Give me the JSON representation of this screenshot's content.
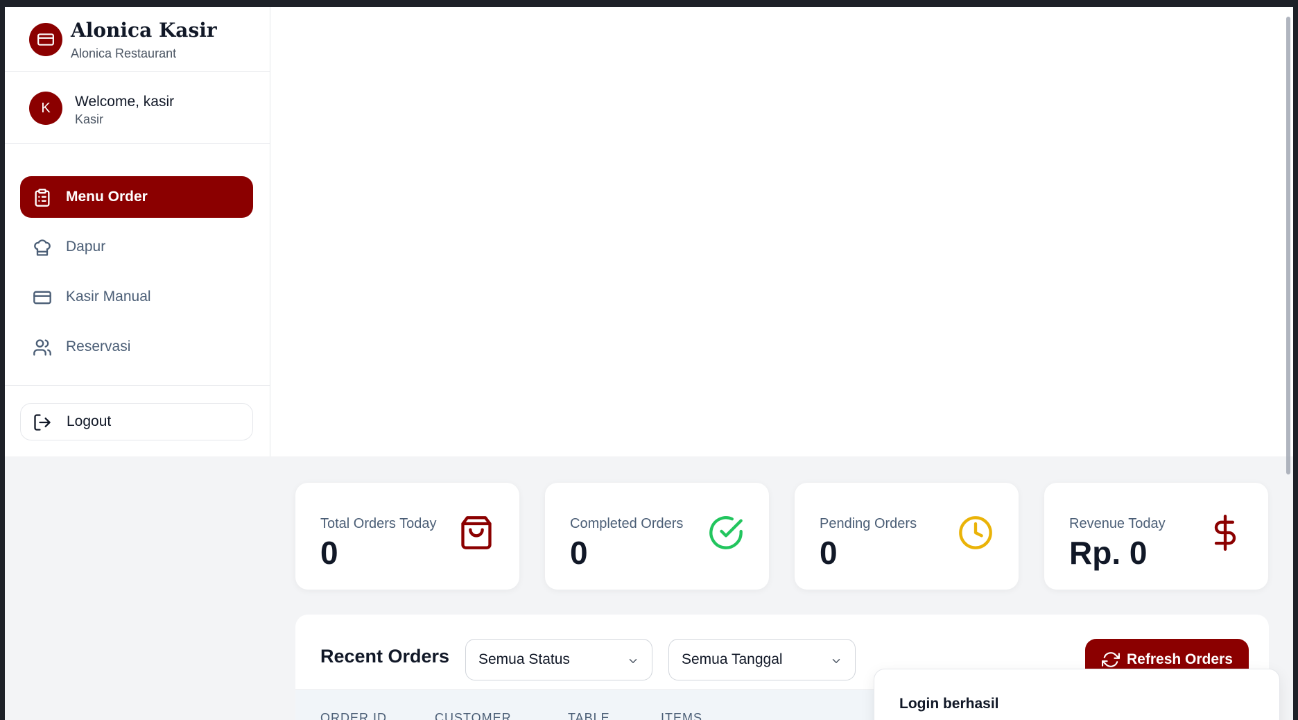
{
  "brand": {
    "title": "Alonica Kasir",
    "subtitle": "Alonica Restaurant",
    "icon": "credit-card-icon"
  },
  "user": {
    "avatar_initial": "K",
    "welcome": "Welcome, kasir",
    "role": "Kasir"
  },
  "nav": {
    "items": [
      {
        "label": "Menu Order",
        "icon": "clipboard-list-icon",
        "active": true
      },
      {
        "label": "Dapur",
        "icon": "chef-hat-icon",
        "active": false
      },
      {
        "label": "Kasir Manual",
        "icon": "credit-card-icon",
        "active": false
      },
      {
        "label": "Reservasi",
        "icon": "users-icon",
        "active": false
      }
    ],
    "logout_label": "Logout"
  },
  "stats": [
    {
      "label": "Total Orders Today",
      "value": "0",
      "icon": "shopping-bag-icon",
      "color": "#8b0000"
    },
    {
      "label": "Completed Orders",
      "value": "0",
      "icon": "check-circle-icon",
      "color": "#22c55e"
    },
    {
      "label": "Pending Orders",
      "value": "0",
      "icon": "clock-icon",
      "color": "#eab308"
    },
    {
      "label": "Revenue Today",
      "value": "Rp. 0",
      "icon": "dollar-sign-icon",
      "color": "#8b0000"
    }
  ],
  "orders": {
    "title": "Recent Orders",
    "status_filter": "Semua Status",
    "date_filter": "Semua Tanggal",
    "refresh_label": "Refresh Orders",
    "columns": [
      "ORDER ID",
      "CUSTOMER",
      "TABLE",
      "ITEMS"
    ]
  },
  "toast": {
    "title": "Login berhasil"
  },
  "colors": {
    "primary": "#8b0000",
    "text_muted": "#4b5e76"
  }
}
